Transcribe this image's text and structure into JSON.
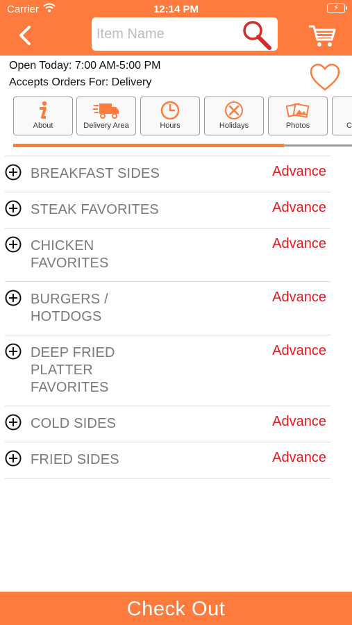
{
  "status_bar": {
    "carrier": "Carrier",
    "time": "12:14 PM"
  },
  "search": {
    "placeholder": "Item Name"
  },
  "store": {
    "hours": "Open Today: 7:00 AM-5:00 PM",
    "orders": "Accepts Orders For: Delivery"
  },
  "tabs": [
    {
      "label": "About",
      "icon": "info-icon"
    },
    {
      "label": "Delivery Area",
      "icon": "delivery-truck-icon"
    },
    {
      "label": "Hours",
      "icon": "clock-icon"
    },
    {
      "label": "Holidays",
      "icon": "fork-knife-icon"
    },
    {
      "label": "Photos",
      "icon": "photos-icon"
    },
    {
      "label": "C",
      "icon": "partial-tab-icon"
    }
  ],
  "tab_scroll_progress": 0.8,
  "menu": [
    {
      "label": "BREAKFAST SIDES",
      "badge": "Advance"
    },
    {
      "label": "STEAK FAVORITES",
      "badge": "Advance"
    },
    {
      "label": "CHICKEN FAVORITES",
      "badge": "Advance"
    },
    {
      "label": "BURGERS / HOTDOGS",
      "badge": "Advance"
    },
    {
      "label": "DEEP FRIED PLATTER FAVORITES",
      "badge": "Advance"
    },
    {
      "label": "COLD SIDES",
      "badge": "Advance"
    },
    {
      "label": "FRIED SIDES",
      "badge": "Advance"
    }
  ],
  "checkout_label": "Check Out",
  "colors": {
    "accent": "#FF7A3D",
    "badge": "#e8171f",
    "search_icon": "#d62a2a"
  }
}
